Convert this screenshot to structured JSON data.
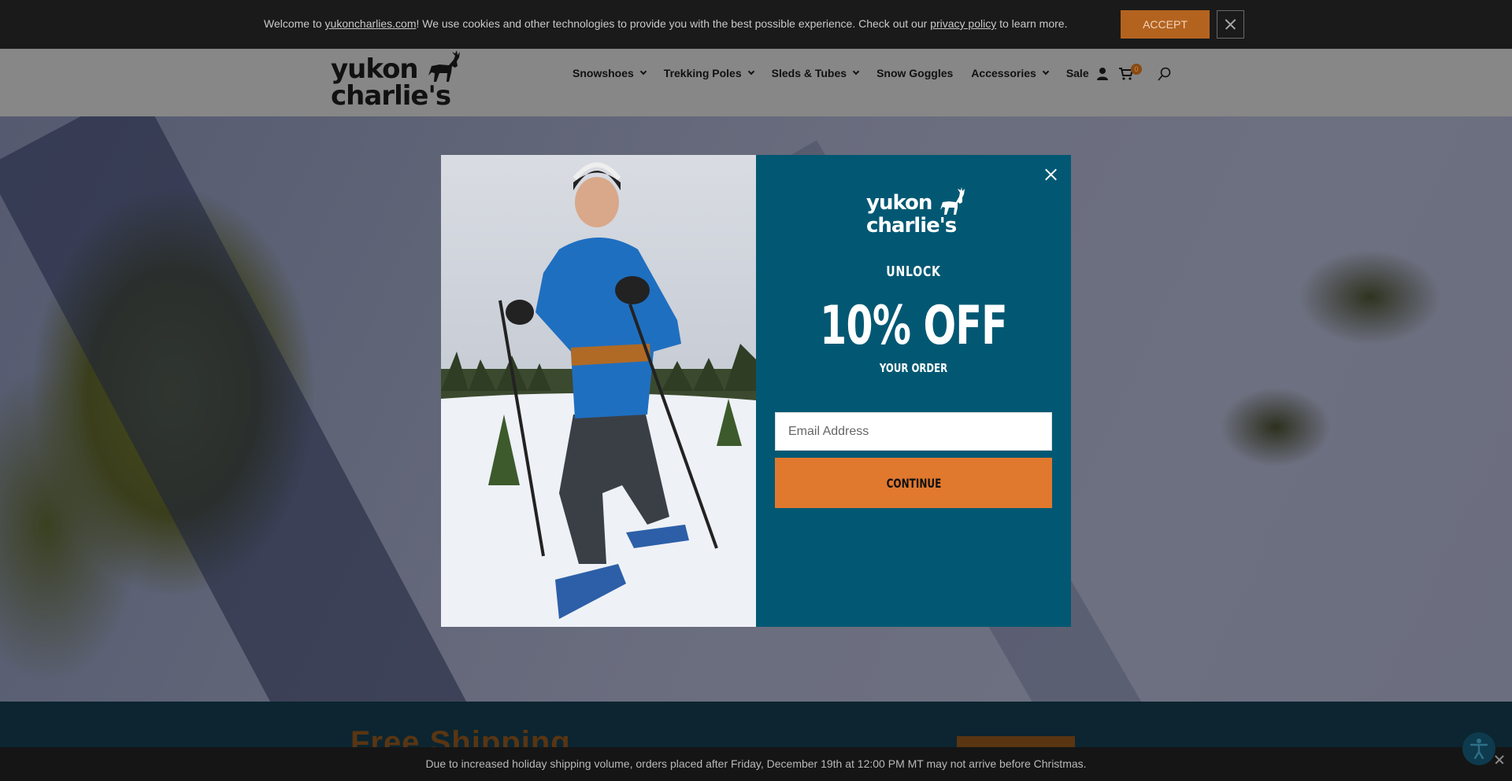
{
  "cookie_bar": {
    "prefix": "Welcome to ",
    "site_link": "yukoncharlies.com",
    "middle": "! We use cookies and other technologies to provide you with the best possible experience. Check out our ",
    "policy_link": "privacy policy",
    "suffix": " to learn more.",
    "accept_label": "ACCEPT",
    "accept_color": "#b4631f"
  },
  "header": {
    "logo_text": [
      "yukon",
      "charlie's"
    ],
    "nav": [
      {
        "label": "Snowshoes",
        "has_dropdown": true
      },
      {
        "label": "Trekking Poles",
        "has_dropdown": true
      },
      {
        "label": "Sleds & Tubes",
        "has_dropdown": true
      },
      {
        "label": "Snow Goggles",
        "has_dropdown": false
      },
      {
        "label": "Accessories",
        "has_dropdown": true
      },
      {
        "label": "Sale",
        "has_dropdown": false
      }
    ],
    "icons": [
      "user-icon",
      "cart-icon",
      "search-icon"
    ],
    "cart_count": "0"
  },
  "modal": {
    "logo_text": [
      "yukon",
      "charlie's"
    ],
    "unlock": "UNLOCK",
    "discount": "10% OFF",
    "subheading": "YOUR ORDER",
    "email_placeholder": "Email Address",
    "continue_label": "CONTINUE",
    "panel_color": "#025873",
    "button_color": "#e0782e"
  },
  "promo_band": {
    "heading": "Free Shipping"
  },
  "notice_bar": {
    "text": "Due to increased holiday shipping volume, orders placed after Friday, December 19th at 12:00 PM MT may not arrive before Christmas."
  }
}
